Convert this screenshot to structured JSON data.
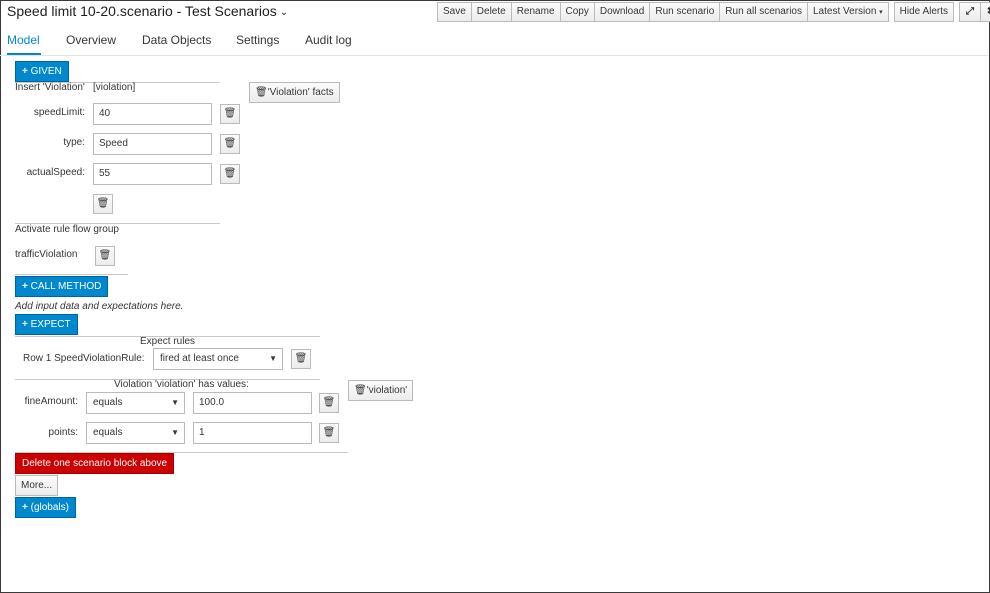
{
  "header": {
    "title": "Speed limit 10-20.scenario - Test Scenarios",
    "chevron": "⌄",
    "toolbar": {
      "save": "Save",
      "delete": "Delete",
      "rename": "Rename",
      "copy": "Copy",
      "download": "Download",
      "run_scenario": "Run scenario",
      "run_all": "Run all scenarios",
      "latest_version": "Latest Version",
      "hide_alerts": "Hide Alerts",
      "expand_icon": "⤢",
      "close_icon": "✖"
    }
  },
  "tabs": [
    {
      "label": "Model",
      "active": true
    },
    {
      "label": "Overview"
    },
    {
      "label": "Data Objects"
    },
    {
      "label": "Settings"
    },
    {
      "label": "Audit log"
    }
  ],
  "given": {
    "button": "GIVEN",
    "insert_label": "Insert 'Violation'",
    "insert_var": "[violation]",
    "facts_button": "'Violation' facts",
    "fields": [
      {
        "label": "speedLimit:",
        "value": "40"
      },
      {
        "label": "type:",
        "value": "Speed"
      },
      {
        "label": "actualSpeed:",
        "value": "55"
      }
    ],
    "activate_label": "Activate rule flow group",
    "flow_group": "trafficViolation"
  },
  "call_method": {
    "button": "CALL METHOD",
    "hint": "Add input data and expectations here."
  },
  "expect": {
    "button": "EXPECT",
    "rules_heading": "Expect rules",
    "rule_label": "Row 1 SpeedViolationRule:",
    "rule_value": "fired at least once",
    "values_heading": "Violation 'violation' has values:",
    "violation_button": "'violation'",
    "fields": [
      {
        "label": "fineAmount:",
        "op": "equals",
        "value": "100.0"
      },
      {
        "label": "points:",
        "op": "equals",
        "value": "1"
      }
    ]
  },
  "footer": {
    "delete_block": "Delete one scenario block above",
    "more": "More...",
    "globals": "(globals)"
  },
  "icons": {
    "plus": "+",
    "trash": "🗑",
    "caret": "▾"
  },
  "colors": {
    "primary": "#0088ce",
    "danger": "#cc0000"
  }
}
